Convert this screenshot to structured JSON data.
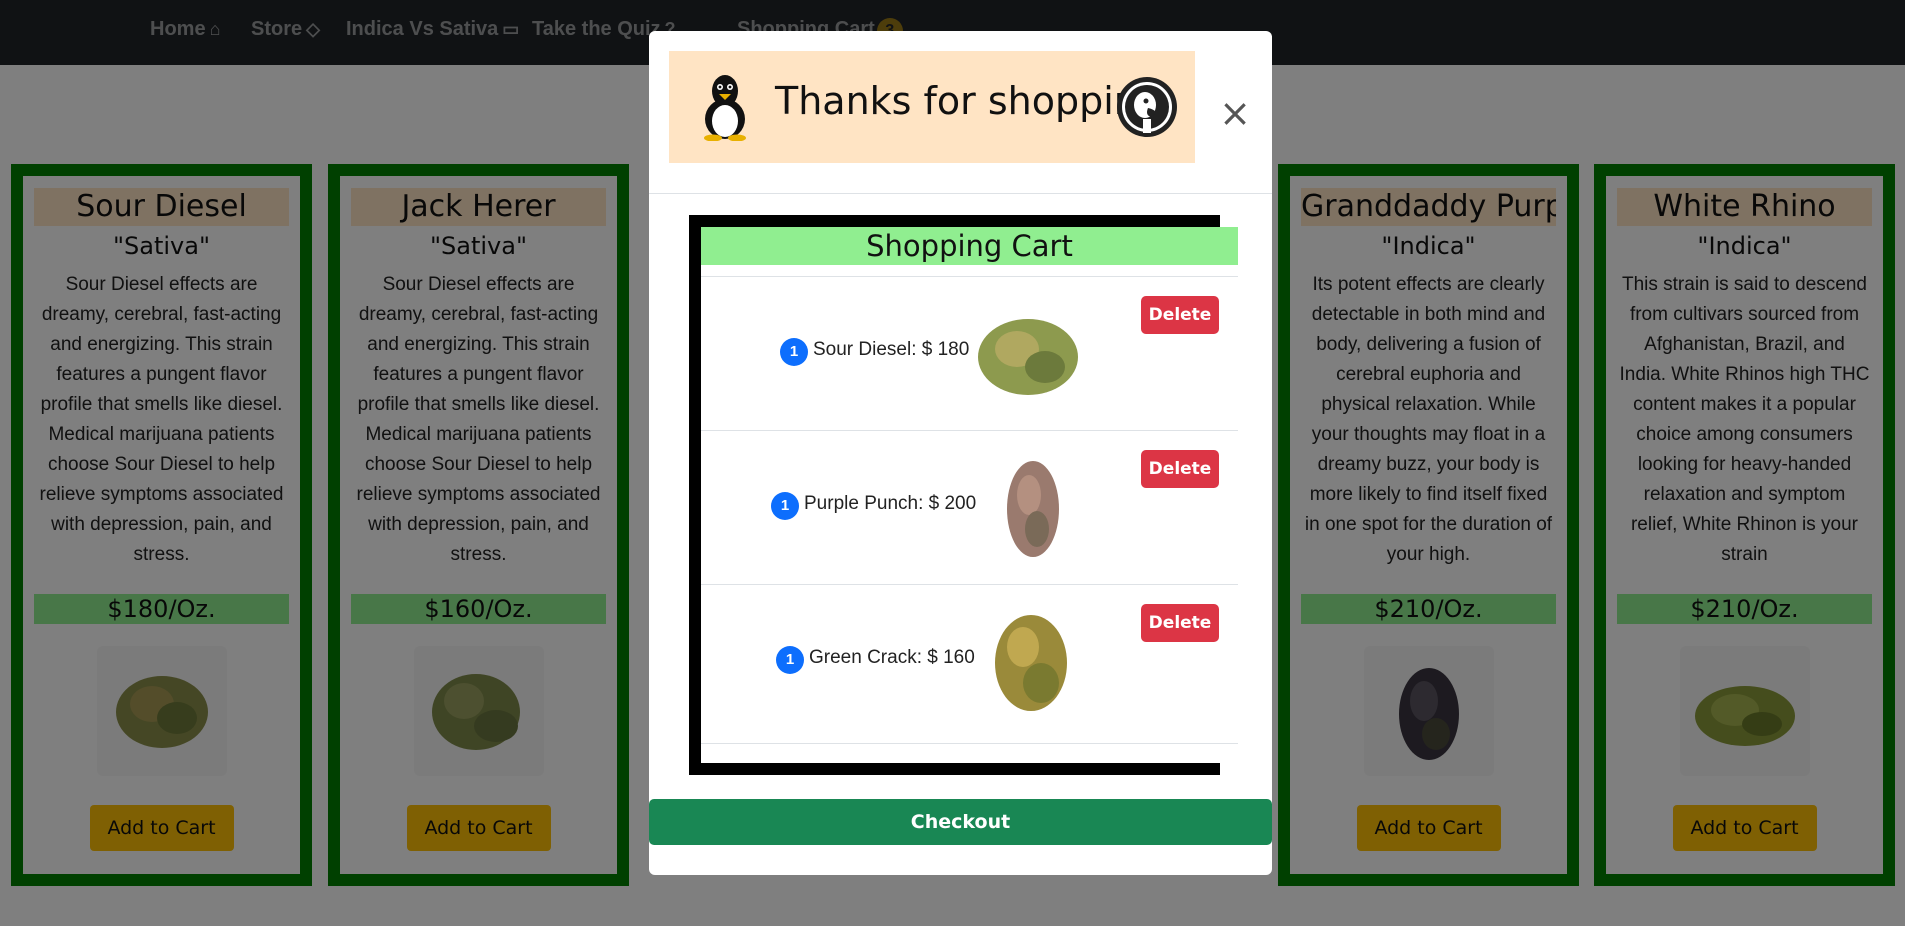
{
  "navbar": {
    "home": "Home",
    "store": "Store",
    "indica_vs_sativa": "Indica Vs Sativa",
    "quiz": "Take the Quiz",
    "cart": "Shopping Cart",
    "cart_count": "3"
  },
  "cards": [
    {
      "title": "Sour Diesel",
      "type": "\"Sativa\"",
      "desc": "Sour Diesel effects are dreamy, cerebral, fast-acting and energizing. This strain features a pungent flavor profile that smells like diesel. Medical marijuana patients choose Sour Diesel to help relieve symptoms associated with depression, pain, and stress.",
      "price": "$180/Oz.",
      "button": "Add to Cart"
    },
    {
      "title": "Jack Herer",
      "type": "\"Sativa\"",
      "desc": "Sour Diesel effects are dreamy, cerebral, fast-acting and energizing. This strain features a pungent flavor profile that smells like diesel. Medical marijuana patients choose Sour Diesel to help relieve symptoms associated with depression, pain, and stress.",
      "price": "$160/Oz.",
      "button": "Add to Cart"
    },
    {
      "title": "Granddaddy Purp",
      "type": "\"Indica\"",
      "desc": "Its potent effects are clearly detectable in both mind and body, delivering a fusion of cerebral euphoria and physical relaxation. While your thoughts may float in a dreamy buzz, your body is more likely to find itself fixed in one spot for the duration of your high.",
      "price": "$210/Oz.",
      "button": "Add to Cart"
    },
    {
      "title": "White Rhino",
      "type": "\"Indica\"",
      "desc": "This strain is said to descend from cultivars sourced from Afghanistan, Brazil, and India. White Rhinos high THC content makes it a popular choice among consumers looking for heavy-handed relaxation and symptom relief, White Rhinon is your strain",
      "price": "$210/Oz.",
      "button": "Add to Cart"
    }
  ],
  "modal": {
    "header_title": "Thanks for shopping",
    "close_symbol": "×",
    "cart_title": "Shopping Cart",
    "items": [
      {
        "qty": "1",
        "text": "Sour Diesel: $ 180",
        "delete": "Delete"
      },
      {
        "qty": "1",
        "text": "Purple Punch: $ 200",
        "delete": "Delete"
      },
      {
        "qty": "1",
        "text": "Green Crack: $ 160",
        "delete": "Delete"
      }
    ],
    "checkout": "Checkout"
  },
  "colors": {
    "navbar": "#212529",
    "card_border": "#008000",
    "title_bg": "#ffe4c4",
    "price_bg": "#90ee90",
    "add_button": "#ffc107",
    "delete_button": "#dc3545",
    "checkout_button": "#198754",
    "qty_badge": "#0d6efd"
  }
}
